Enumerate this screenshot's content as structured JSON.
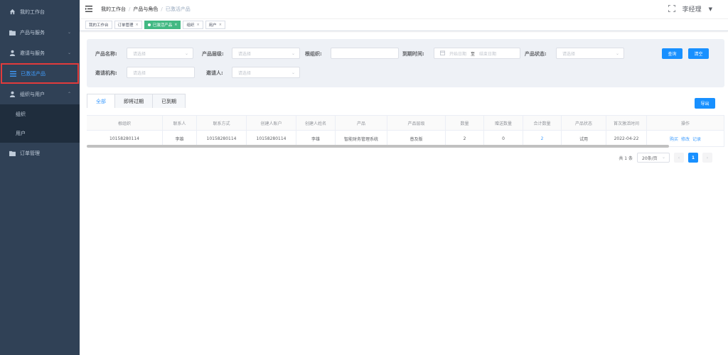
{
  "sidebar": {
    "items": [
      {
        "label": "我的工作台"
      },
      {
        "label": "产品与服务"
      },
      {
        "label": "邀请与服务"
      },
      {
        "label": "已激活产品"
      },
      {
        "label": "组织与用户"
      },
      {
        "label": "组织"
      },
      {
        "label": "用户"
      },
      {
        "label": "订单管理"
      }
    ]
  },
  "header": {
    "breadcrumb": [
      "我的工作台",
      "产品与角色",
      "已激活产品"
    ],
    "user_name": "李经理"
  },
  "tags": [
    "我的工作台",
    "订单管理",
    "已激活产品",
    "组织",
    "用户"
  ],
  "filter": {
    "product_name_label": "产品名称:",
    "product_name_placeholder": "请选择",
    "product_level_label": "产品层级:",
    "product_level_placeholder": "请选择",
    "root_org_label": "根组织:",
    "expire_label": "到期时间:",
    "start_date_placeholder": "开始日期",
    "to_text": "至",
    "end_date_placeholder": "结束日期",
    "status_label": "产品状态:",
    "status_placeholder": "请选择",
    "invite_org_label": "邀请机构:",
    "invite_org_placeholder": "请选择",
    "inviter_label": "邀请人:",
    "inviter_placeholder": "请选择",
    "query_button": "查询",
    "clear_button": "清空"
  },
  "tabs": [
    "全部",
    "即将过期",
    "已到期"
  ],
  "export_button": "导出",
  "table": {
    "headers": [
      "根组织",
      "联系人",
      "联系方式",
      "创建人账户",
      "创建人姓名",
      "产品",
      "产品层级",
      "数量",
      "赠送数量",
      "合计数量",
      "产品状态",
      "首次激活时间",
      "操作"
    ],
    "rows": [
      [
        "10158280114",
        "李雄",
        "10158280114",
        "10158280114",
        "李雄",
        "智能财务管理系统",
        "普及版",
        "2",
        "0",
        "2",
        "试用",
        "2022-04-22"
      ]
    ],
    "actions": [
      "购买",
      "修改",
      "记录"
    ]
  },
  "pagination": {
    "total": "共 1 条",
    "page_size": "20条/页",
    "current_page": "1"
  }
}
